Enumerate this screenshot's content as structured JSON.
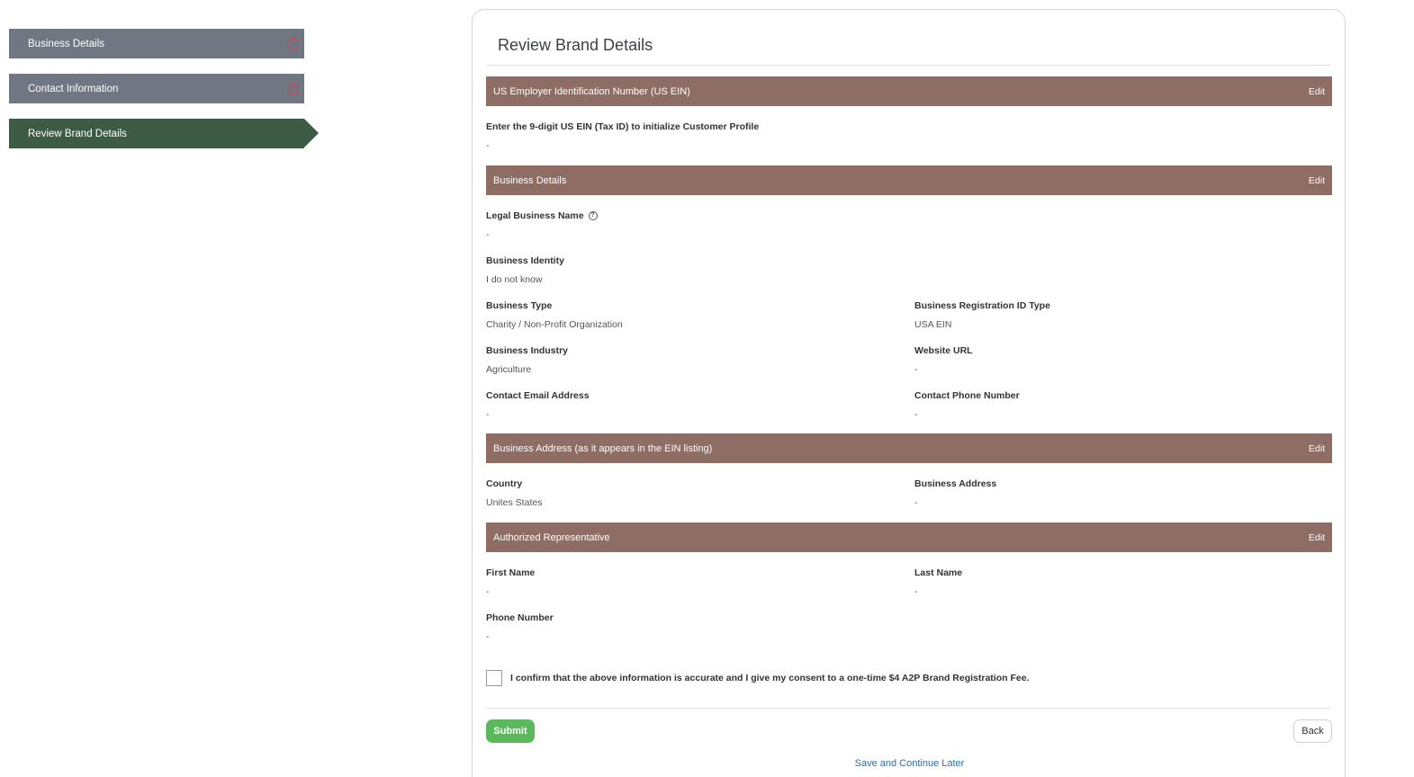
{
  "sidebar": {
    "steps": [
      {
        "label": "Business Details",
        "status": "incomplete"
      },
      {
        "label": "Contact Information",
        "status": "incomplete"
      },
      {
        "label": "Review Brand Details",
        "status": "active"
      }
    ],
    "alert_glyph": "!"
  },
  "card": {
    "title": "Review Brand Details",
    "edit_label": "Edit",
    "sections": {
      "ein": {
        "title": "US Employer Identification Number (US EIN)",
        "fields": {
          "ein": {
            "label": "Enter the 9-digit US EIN (Tax ID) to initialize Customer Profile",
            "value": "-"
          }
        }
      },
      "business": {
        "title": "Business Details",
        "fields": {
          "legal_name": {
            "label": "Legal Business Name",
            "value": "-"
          },
          "identity": {
            "label": "Business Identity",
            "value": "I do not know"
          },
          "type": {
            "label": "Business Type",
            "value": "Charity / Non-Profit Organization"
          },
          "reg_id_type": {
            "label": "Business Registration ID Type",
            "value": "USA EIN"
          },
          "industry": {
            "label": "Business Industry",
            "value": "Agriculture"
          },
          "website": {
            "label": "Website URL",
            "value": "-"
          },
          "email": {
            "label": "Contact Email Address",
            "value": "-"
          },
          "phone": {
            "label": "Contact Phone Number",
            "value": "-"
          }
        }
      },
      "address": {
        "title": "Business Address (as it appears in the EIN listing)",
        "fields": {
          "country": {
            "label": "Country",
            "value": "Unites States"
          },
          "address": {
            "label": "Business Address",
            "value": "-"
          }
        }
      },
      "rep": {
        "title": "Authorized Representative",
        "fields": {
          "first_name": {
            "label": "First Name",
            "value": "-"
          },
          "last_name": {
            "label": "Last Name",
            "value": "-"
          },
          "phone": {
            "label": "Phone Number",
            "value": "-"
          }
        }
      }
    },
    "help_glyph": "?",
    "consent_text": "I confirm that the above information is accurate and I give my consent to a one-time $4 A2P Brand Registration Fee.",
    "consent_checked": false,
    "submit_label": "Submit",
    "back_label": "Back",
    "save_later_label": "Save and Continue Later"
  },
  "colors": {
    "step_incomplete": "#707782",
    "step_active": "#3d5a45",
    "section_bar": "#8e6d64",
    "submit": "#5cb85c",
    "alert": "#d1435b",
    "link": "#2e6fa7"
  }
}
